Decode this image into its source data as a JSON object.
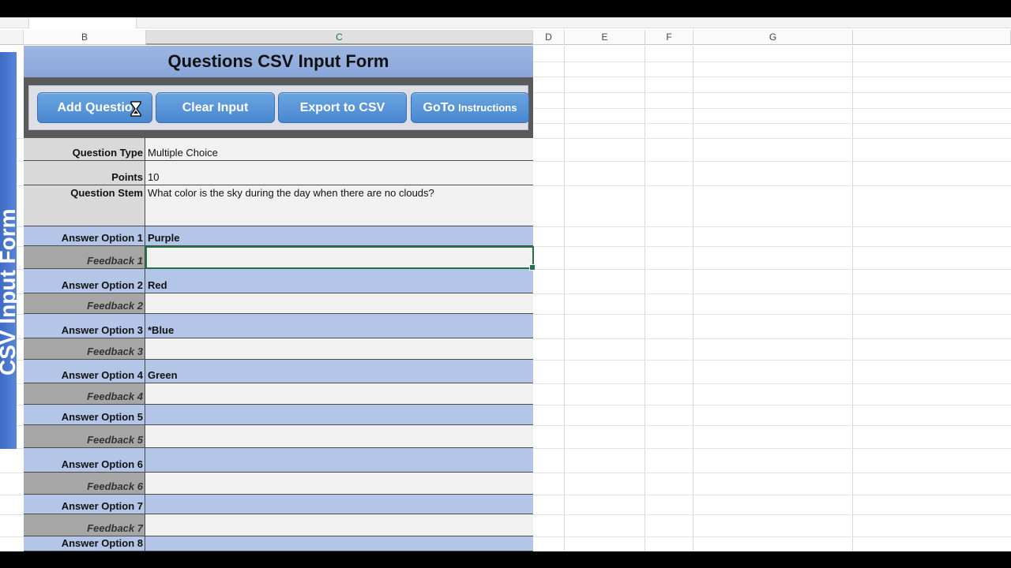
{
  "columns": [
    "B",
    "C",
    "D",
    "E",
    "F",
    "G"
  ],
  "side_title": "CSV Input Form",
  "form": {
    "title": "Questions CSV Input Form",
    "buttons": {
      "add_question": "Add Questio",
      "clear_input": "Clear Input",
      "export_csv": "Export to CSV",
      "goto_main": "GoTo",
      "goto_small": "Instructions"
    },
    "rows": [
      {
        "label": "Question Type",
        "value": "Multiple Choice"
      },
      {
        "label": "Points",
        "value": "10"
      },
      {
        "label": "Question Stem",
        "value": "What color is the sky during the day when there are no clouds?"
      },
      {
        "label": "Answer Option 1",
        "value": "Purple"
      },
      {
        "label": "Feedback 1",
        "value": ""
      },
      {
        "label": "Answer Option 2",
        "value": "Red"
      },
      {
        "label": "Feedback 2",
        "value": ""
      },
      {
        "label": "Answer Option 3",
        "value": "*Blue"
      },
      {
        "label": "Feedback 3",
        "value": ""
      },
      {
        "label": "Answer Option 4",
        "value": "Green"
      },
      {
        "label": "Feedback 4",
        "value": ""
      },
      {
        "label": "Answer Option 5",
        "value": ""
      },
      {
        "label": "Feedback 5",
        "value": ""
      },
      {
        "label": "Answer Option 6",
        "value": ""
      },
      {
        "label": "Feedback 6",
        "value": ""
      },
      {
        "label": "Answer Option 7",
        "value": ""
      },
      {
        "label": "Feedback 7",
        "value": ""
      },
      {
        "label": "Answer Option 8",
        "value": ""
      }
    ]
  },
  "colors": {
    "accent_blue": "#4a86cf",
    "answer_row": "#b4c6e7",
    "feedback_label": "#a6a6a6",
    "selection": "#217346"
  },
  "cursor_icon": "hourglass-cursor-icon"
}
